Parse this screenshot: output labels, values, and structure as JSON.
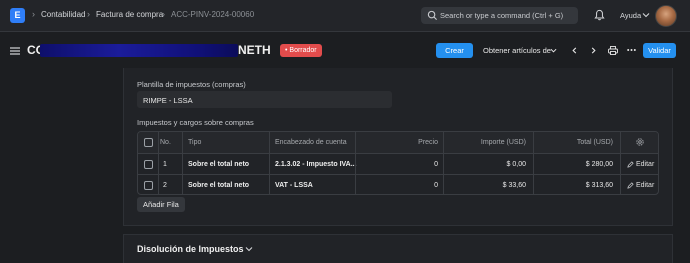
{
  "app": {
    "logo_letter": "E"
  },
  "breadcrumb": {
    "items": [
      "Contabilidad",
      "Factura de compra",
      "ACC-PINV-2024-00060"
    ],
    "separator": "›"
  },
  "search": {
    "placeholder": "Search or type a command (Ctrl + G)"
  },
  "header": {
    "help_label": "Ayuda"
  },
  "page": {
    "title_visible_start": "CO",
    "title_visible_end": "NETH",
    "status_badge": "• Borrador",
    "create_label": "Crear",
    "get_items_label": "Obtener artículos de",
    "submit_label": "Validar"
  },
  "form": {
    "tax_template_label": "Plantilla de impuestos (compras)",
    "tax_template_value": "RIMPE - LSSA",
    "taxes_table_label": "Impuestos y cargos sobre compras",
    "add_row_label": "Añadir Fila"
  },
  "table": {
    "columns": [
      "No.",
      "Tipo",
      "Encabezado de cuenta",
      "Precio",
      "Importe (USD)",
      "Total (USD)"
    ],
    "rows": [
      {
        "no": "1",
        "type": "Sobre el total neto",
        "account": "2.1.3.02 - Impuesto IVA...",
        "rate": "0",
        "amount": "$ 0,00",
        "total": "$ 280,00",
        "edit": "Editar"
      },
      {
        "no": "2",
        "type": "Sobre el total neto",
        "account": "VAT - LSSA",
        "rate": "0",
        "amount": "$ 33,60",
        "total": "$ 313,60",
        "edit": "Editar"
      }
    ]
  },
  "section": {
    "title": "Disolución de Impuestos"
  },
  "colors": {
    "accent": "#2490ef",
    "draft": "#e24c4c",
    "background": "#1c1e21"
  }
}
